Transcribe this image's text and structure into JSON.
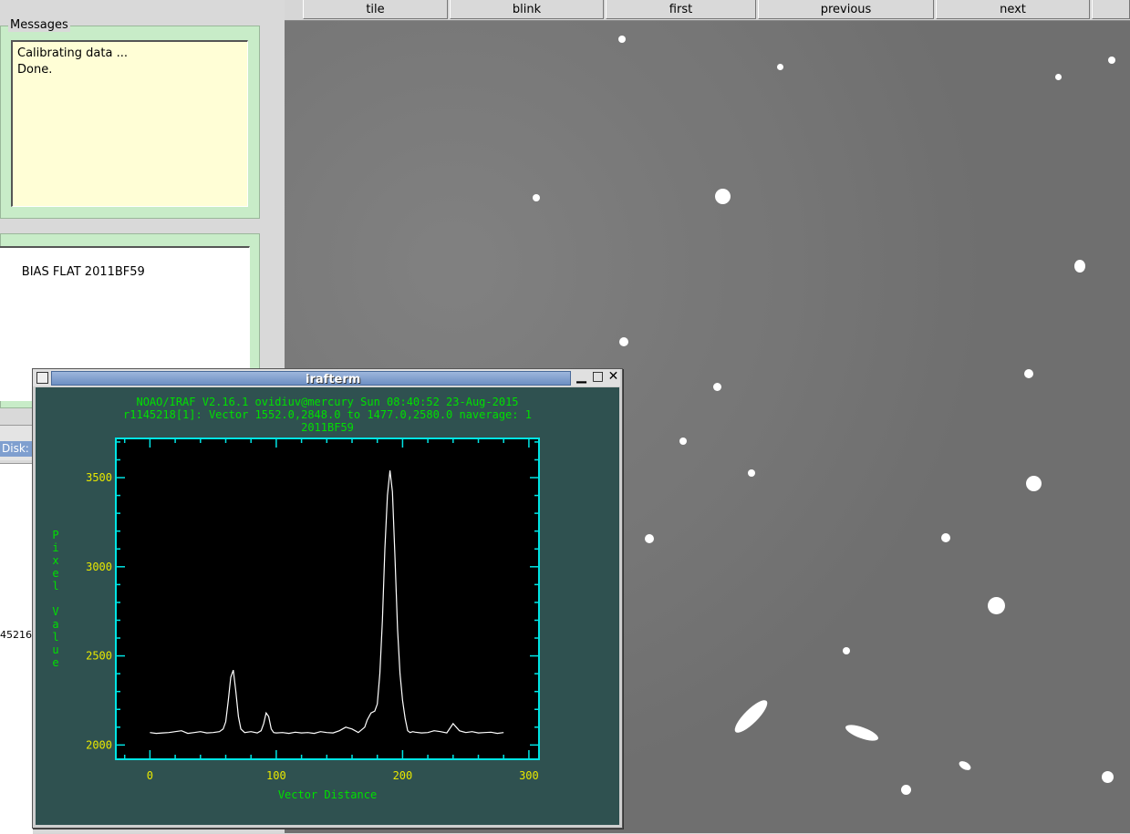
{
  "messages": {
    "title": "Messages",
    "lines": [
      "Calibrating data ...",
      "Done."
    ]
  },
  "file_list": {
    "line": "BIAS FLAT 2011BF59"
  },
  "status": {
    "disk_label": "Disk:",
    "fragment_number": "45216"
  },
  "toolbar": {
    "buttons": [
      "tile",
      "blink",
      "first",
      "previous",
      "next"
    ]
  },
  "window": {
    "title": "irafterm"
  },
  "colors": {
    "plot_bg": "#000000",
    "frame": "#00e5e5",
    "text_green": "#00e000",
    "tick_yellow": "#e8e800",
    "window_bg": "#2f5150"
  },
  "chart_data": {
    "type": "line",
    "header_lines": [
      "NOAO/IRAF V2.16.1 ovidiuv@mercury Sun 08:40:52 23-Aug-2015",
      "r1145218[1]: Vector 1552.0,2848.0 to 1477.0,2580.0 naverage: 1",
      "2011BF59"
    ],
    "xlabel": "Vector Distance",
    "ylabel": "Pixel Value",
    "xlim": [
      -27,
      308
    ],
    "ylim": [
      1920,
      3720
    ],
    "xticks": [
      0,
      100,
      200,
      300
    ],
    "yticks": [
      2000,
      2500,
      3000,
      3500
    ],
    "series": [
      {
        "x": [
          0,
          5,
          10,
          15,
          20,
          25,
          30,
          35,
          40,
          45,
          50,
          55,
          58,
          60,
          62,
          64,
          66,
          68,
          70,
          72,
          75,
          80,
          85,
          88,
          90,
          92,
          94,
          96,
          98,
          100,
          105,
          110,
          115,
          120,
          125,
          130,
          135,
          140,
          145,
          150,
          155,
          160,
          165,
          170,
          172,
          175,
          178,
          180,
          182,
          184,
          186,
          188,
          190,
          192,
          194,
          196,
          198,
          200,
          202,
          204,
          206,
          208,
          210,
          215,
          220,
          225,
          230,
          235,
          240,
          245,
          250,
          255,
          260,
          265,
          270,
          275,
          280
        ],
        "y": [
          2070,
          2065,
          2068,
          2070,
          2075,
          2080,
          2065,
          2070,
          2075,
          2068,
          2070,
          2075,
          2090,
          2130,
          2250,
          2380,
          2420,
          2300,
          2160,
          2090,
          2070,
          2075,
          2068,
          2080,
          2120,
          2180,
          2160,
          2090,
          2070,
          2068,
          2070,
          2065,
          2072,
          2068,
          2070,
          2065,
          2075,
          2070,
          2068,
          2080,
          2100,
          2090,
          2070,
          2100,
          2140,
          2180,
          2190,
          2230,
          2400,
          2700,
          3100,
          3400,
          3540,
          3420,
          3050,
          2650,
          2400,
          2250,
          2150,
          2080,
          2070,
          2075,
          2072,
          2068,
          2070,
          2080,
          2075,
          2068,
          2120,
          2080,
          2070,
          2075,
          2068,
          2070,
          2072,
          2065,
          2070
        ]
      }
    ]
  }
}
